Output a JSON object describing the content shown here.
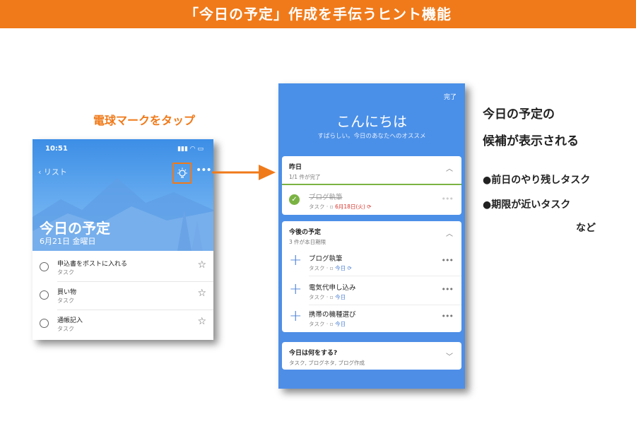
{
  "banner": {
    "title": "「今日の予定」作成を手伝うヒント機能"
  },
  "instruction": {
    "tap_bulb": "電球マークをタップ"
  },
  "left_phone": {
    "status_time": "10:51",
    "back_label": "リスト",
    "title": "今日の予定",
    "date": "6月21日 金曜日",
    "tasks": [
      {
        "name": "申込書をポストに入れる",
        "sub": "タスク"
      },
      {
        "name": "買い物",
        "sub": "タスク"
      },
      {
        "name": "通帳記入",
        "sub": "タスク"
      }
    ]
  },
  "right_phone": {
    "done_label": "完了",
    "greeting": "こんにちは",
    "greeting_sub": "すばらしい。今日のあなたへのオススメ",
    "yesterday": {
      "title": "昨日",
      "sub": "1/1 件が完了",
      "item": {
        "name": "ブログ執筆",
        "type": "タスク",
        "due": "6月18日(火)"
      }
    },
    "upcoming": {
      "title": "今後の予定",
      "sub": "3 件が本日期限",
      "items": [
        {
          "name": "ブログ執筆",
          "type": "タスク",
          "due": "今日"
        },
        {
          "name": "電気代申し込み",
          "type": "タスク",
          "due": "今日"
        },
        {
          "name": "携帯の機種選び",
          "type": "タスク",
          "due": "今日"
        }
      ]
    },
    "today_q": {
      "title": "今日は何をする?",
      "sub": "タスク, ブログネタ, ブログ作成"
    }
  },
  "explanation": {
    "line1": "今日の予定の",
    "line2": "候補が表示される",
    "bullet1": "●前日のやり残しタスク",
    "bullet2": "●期限が近いタスク",
    "etc": "など"
  },
  "colors": {
    "accent": "#f07a1a",
    "blue": "#4a90e8",
    "green": "#7bb343",
    "red": "#d9342b"
  }
}
